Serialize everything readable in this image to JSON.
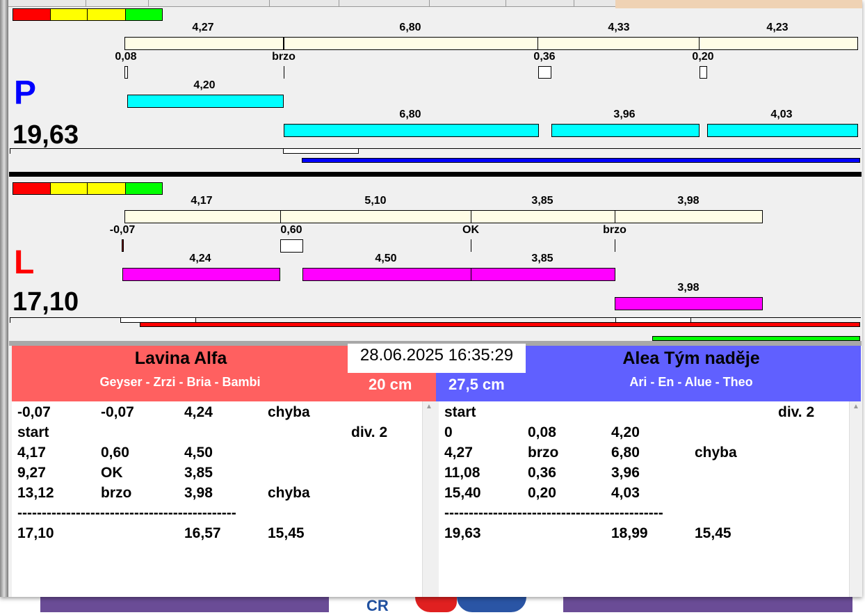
{
  "colors": {
    "red": "#ff0000",
    "yellow": "#ffff00",
    "green": "#00ff00",
    "cyan": "#00ffff",
    "magenta": "#ff00ff",
    "left_team": "#ff6060",
    "right_team": "#6060ff"
  },
  "track_p": {
    "letter": "P",
    "total": "19,63",
    "split_labels": [
      "4,27",
      "6,80",
      "4,33",
      "4,23"
    ],
    "exchange_labels": [
      "0,08",
      "brzo",
      "0,36",
      "0,20"
    ],
    "runs": [
      "4,20",
      "6,80",
      "3,96",
      "4,03"
    ]
  },
  "track_l": {
    "letter": "L",
    "total": "17,10",
    "split_labels": [
      "4,17",
      "5,10",
      "3,85",
      "3,98"
    ],
    "exchange_labels": [
      "-0,07",
      "0,60",
      "OK",
      "brzo"
    ],
    "runs": [
      "4,24",
      "4,50",
      "3,85",
      "3,98"
    ]
  },
  "datetime": "28.06.2025 16:35:29",
  "left_team": {
    "name": "Lavina Alfa",
    "members": "Geyser - Zrzi - Bria - Bambi",
    "height": "20 cm",
    "rows": [
      [
        "-0,07",
        "-0,07",
        "4,24",
        "chyba",
        ""
      ],
      [
        "start",
        "",
        "",
        "",
        "div.  2"
      ],
      [
        "4,17",
        "0,60",
        "4,50",
        "",
        ""
      ],
      [
        "9,27",
        "OK",
        "3,85",
        "",
        ""
      ],
      [
        "13,12",
        "brzo",
        "3,98",
        "chyba",
        ""
      ],
      [
        "---------------------------------------------",
        "",
        "",
        "",
        ""
      ],
      [
        "17,10",
        "",
        "16,57",
        "15,45",
        ""
      ]
    ]
  },
  "right_team": {
    "name": "Alea Tým naděje",
    "members": "Ari - En - Alue - Theo",
    "height": "27,5 cm",
    "rows": [
      [
        "start",
        "",
        "",
        "",
        "div.  2"
      ],
      [
        "0",
        "0,08",
        "4,20",
        "",
        ""
      ],
      [
        "4,27",
        "brzo",
        "6,80",
        "chyba",
        ""
      ],
      [
        "11,08",
        "0,36",
        "3,96",
        "",
        ""
      ],
      [
        "15,40",
        "0,20",
        "4,03",
        "",
        ""
      ],
      [
        "---------------------------------------------",
        "",
        "",
        "",
        ""
      ],
      [
        "19,63",
        "",
        "18,99",
        "15,45",
        ""
      ]
    ]
  },
  "background_logo": "CR"
}
